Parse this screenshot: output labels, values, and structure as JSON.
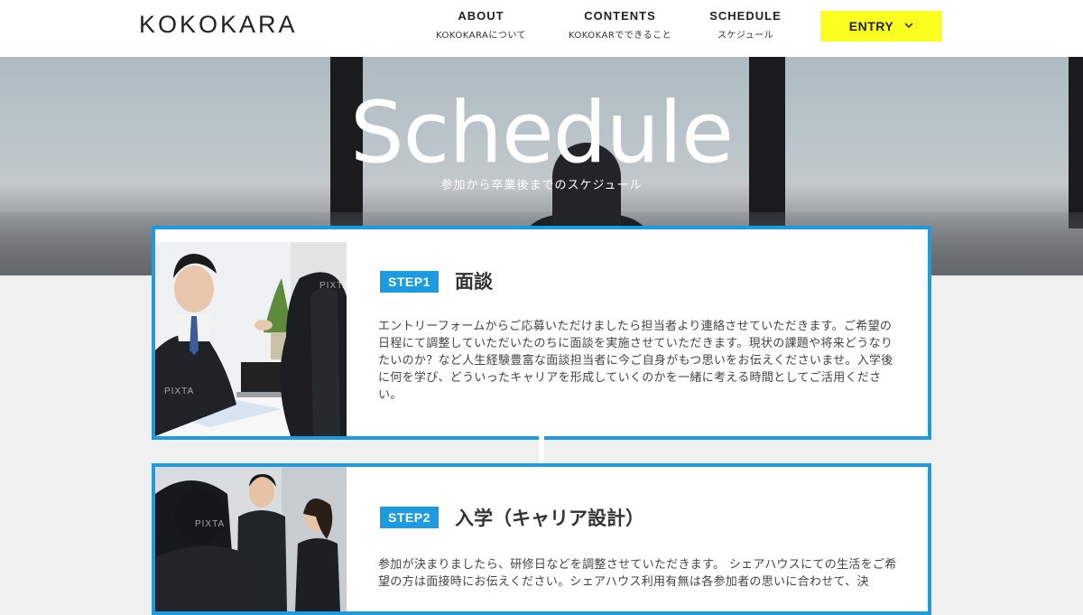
{
  "brand": {
    "logo": "KOKOKARA"
  },
  "nav": [
    {
      "en": "ABOUT",
      "jp": "KOKOKARAについて"
    },
    {
      "en": "CONTENTS",
      "jp": "KOKOKARでできること"
    },
    {
      "en": "SCHEDULE",
      "jp": "スケジュール"
    }
  ],
  "entry": {
    "label": "ENTRY",
    "icon": "chevron-down-icon"
  },
  "hero": {
    "title": "Schedule",
    "subtitle": "参加から卒業後までのスケジュール"
  },
  "steps": [
    {
      "badge": "STEP1",
      "title": "面談",
      "description": "エントリーフォームからご応募いただけましたら担当者より連絡させていただきます。ご希望の日程にて調整していただいたのちに面談を実施させていただきます。現状の課題や将来どうなりたいのか？など人生経験豊富な面談担当者に今ご自身がもつ思いをお伝えくださいませ。入学後に何を学び、どういったキャリアを形成していくのかを一緒に考える時間としてご活用ください。",
      "watermark": "PIXTA"
    },
    {
      "badge": "STEP2",
      "title": "入学（キャリア設計）",
      "description": "参加が決まりましたら、研修日などを調整させていただきます。 シェアハウスにての生活をご希望の方は面接時にお伝えください。シェアハウス利用有無は各参加者の思いに合わせて、決",
      "watermark": "PIXTA"
    }
  ],
  "colors": {
    "accent": "#1d9be0",
    "entry_bg": "#fbff1f"
  }
}
